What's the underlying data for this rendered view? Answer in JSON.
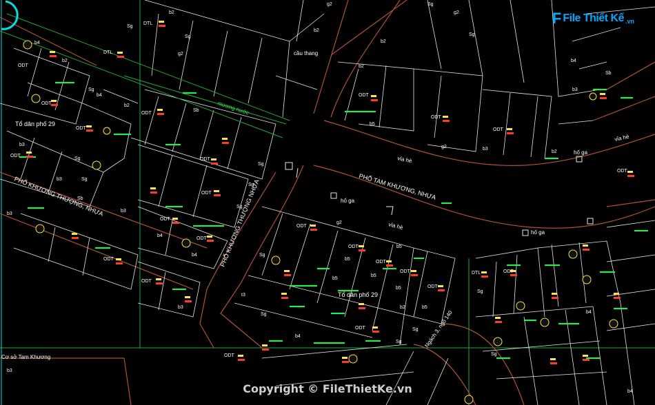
{
  "logo": {
    "mark": "F",
    "text": "File Thiết Kế",
    "suffix": ".vn"
  },
  "copyright": "Copyright © FileThietKe.vn",
  "colors": {
    "background": "#000000",
    "road_edge": "#b0513a",
    "parcel_line": "#e8e8e8",
    "green_line": "#1faa3a",
    "green_text": "#2fe84f",
    "label_white": "#ffffff",
    "label_yellow": "#ffe34d",
    "label_red": "#ff3a2a",
    "cyan_line": "#00e0e0"
  },
  "streets": [
    {
      "id": "tam-khuong",
      "label": "PHỐ TAM KHƯƠNG, NHỰA"
    },
    {
      "id": "khuong-thuong",
      "label": "PHỐ KHƯƠNG THƯỢNG, NHỰA"
    },
    {
      "id": "khuong-thuong-2",
      "label": "PHỐ KHƯƠNG THƯỢNG NHỰA"
    },
    {
      "id": "ngo-140",
      "label": "Ngách 3, ngõ 140"
    }
  ],
  "place_labels": [
    {
      "id": "to-dan-pho-29-a",
      "text": "Tổ dân phố 29"
    },
    {
      "id": "to-dan-pho-29-b",
      "text": "Tổ dân phố 29"
    },
    {
      "id": "co-so-tam-khuong",
      "text": "Cơ sở Tam Khương"
    },
    {
      "id": "cau-thang",
      "text": "cầu thang"
    },
    {
      "id": "via-he-1",
      "text": "vỉa hè"
    },
    {
      "id": "via-he-2",
      "text": "vỉa hè"
    },
    {
      "id": "via-he-3",
      "text": "vỉa hè"
    },
    {
      "id": "ho-ga-1",
      "text": "hố ga"
    },
    {
      "id": "ho-ga-2",
      "text": "hố ga"
    },
    {
      "id": "ho-ga-3",
      "text": "hố ga"
    },
    {
      "id": "muong-nuoc",
      "text": "mương nước"
    }
  ],
  "parcel_codes": [
    "ODT",
    "DTL",
    "Sg",
    "Sb",
    "b2",
    "b3",
    "b4",
    "b5",
    "g2",
    "t3"
  ]
}
